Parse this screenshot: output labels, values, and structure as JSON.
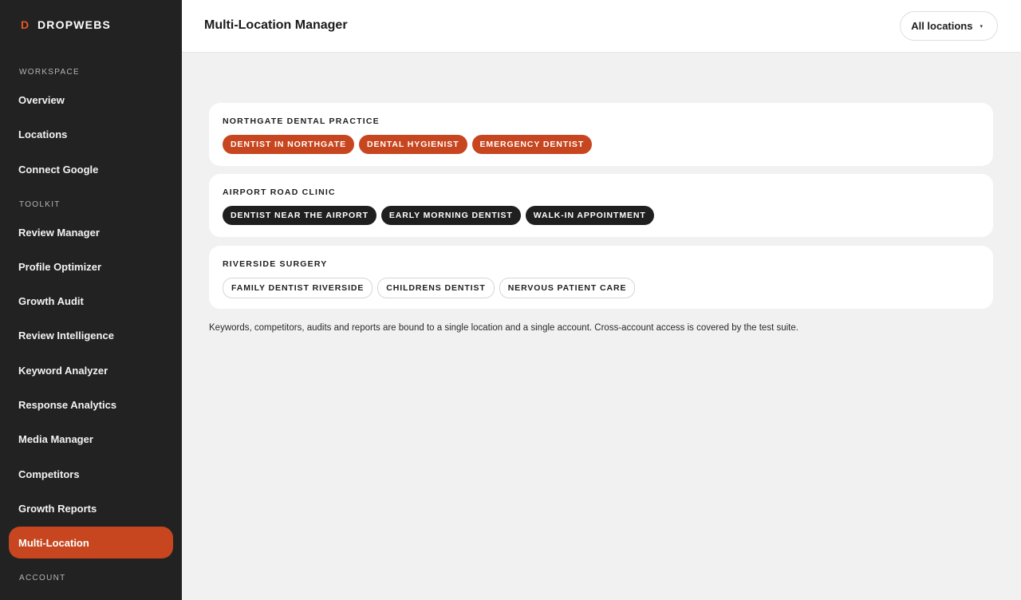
{
  "brand": {
    "mark": "D",
    "name": "DROPWEBS"
  },
  "sidebar": {
    "sections": {
      "workspace": "WORKSPACE",
      "toolkit": "TOOLKIT",
      "account": "ACCOUNT"
    },
    "workspace_items": [
      {
        "label": "Overview"
      },
      {
        "label": "Locations"
      },
      {
        "label": "Connect Google"
      }
    ],
    "toolkit_items": [
      {
        "label": "Review Manager"
      },
      {
        "label": "Profile Optimizer"
      },
      {
        "label": "Growth Audit"
      },
      {
        "label": "Review Intelligence"
      },
      {
        "label": "Keyword Analyzer"
      },
      {
        "label": "Response Analytics"
      },
      {
        "label": "Media Manager"
      },
      {
        "label": "Competitors"
      },
      {
        "label": "Growth Reports"
      },
      {
        "label": "Multi-Location"
      }
    ],
    "active_item": "Multi-Location"
  },
  "header": {
    "title": "Multi-Location Manager",
    "location_select": {
      "value": "All locations",
      "caret": "▾"
    }
  },
  "locations": [
    {
      "name": "NORTHGATE DENTAL PRACTICE",
      "tag_style": "orange",
      "keywords": [
        "DENTIST IN NORTHGATE",
        "DENTAL HYGIENIST",
        "EMERGENCY DENTIST"
      ]
    },
    {
      "name": "AIRPORT ROAD CLINIC",
      "tag_style": "dark",
      "keywords": [
        "DENTIST NEAR THE AIRPORT",
        "EARLY MORNING DENTIST",
        "WALK-IN APPOINTMENT"
      ]
    },
    {
      "name": "RIVERSIDE SURGERY",
      "tag_style": "outline",
      "keywords": [
        "FAMILY DENTIST RIVERSIDE",
        "CHILDRENS DENTIST",
        "NERVOUS PATIENT CARE"
      ]
    }
  ],
  "footnote": "Keywords, competitors, audits and reports are bound to a single location and a single account. Cross-account access is covered by the test suite.",
  "colors": {
    "sidebar_bg": "#222222",
    "accent": "#c7461f",
    "brand_mark": "#e8562b",
    "dark_tag": "#1f1f1f",
    "page_bg": "#f1f1f1"
  }
}
